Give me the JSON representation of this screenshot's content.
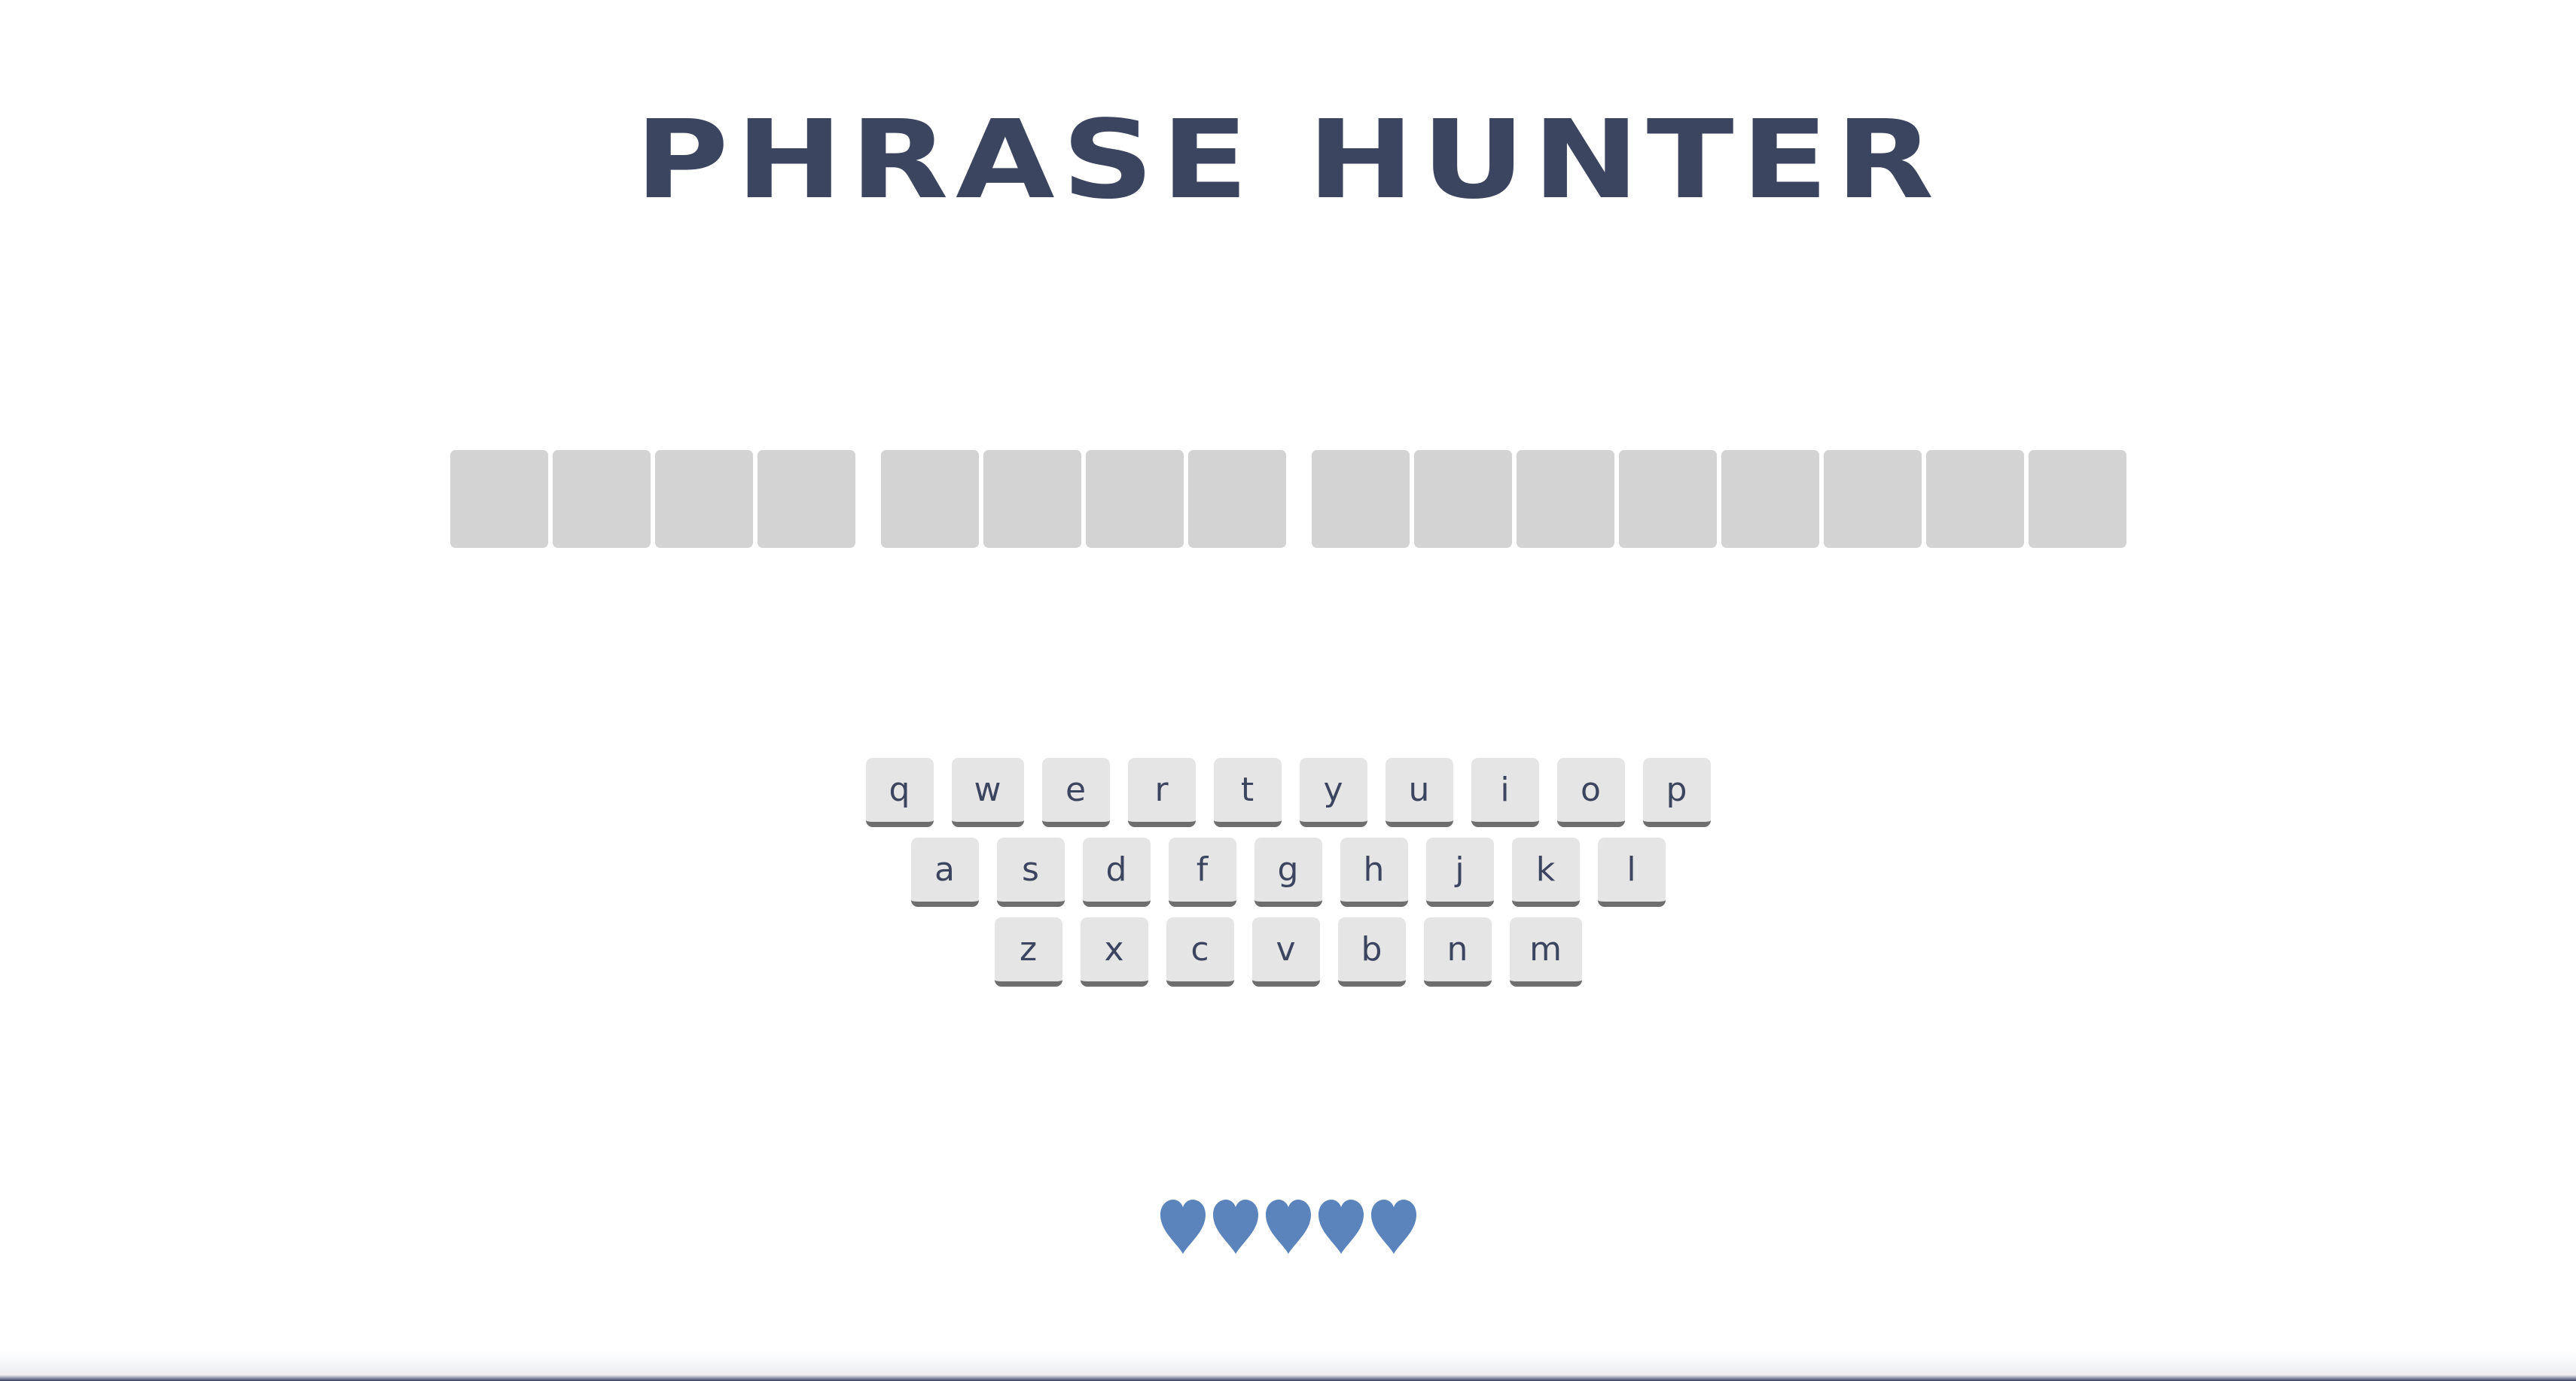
{
  "title": "PHRASE HUNTER",
  "phrase": {
    "words": [
      {
        "letters": [
          "",
          "",
          "",
          ""
        ]
      },
      {
        "letters": [
          "",
          "",
          "",
          ""
        ]
      },
      {
        "letters": [
          "",
          "",
          "",
          "",
          "",
          "",
          "",
          ""
        ]
      }
    ]
  },
  "keyboard": {
    "rows": [
      [
        "q",
        "w",
        "e",
        "r",
        "t",
        "y",
        "u",
        "i",
        "o",
        "p"
      ],
      [
        "a",
        "s",
        "d",
        "f",
        "g",
        "h",
        "j",
        "k",
        "l"
      ],
      [
        "z",
        "x",
        "c",
        "v",
        "b",
        "n",
        "m"
      ]
    ]
  },
  "lives": {
    "remaining": 5,
    "total": 5,
    "icon": "heart-icon",
    "color": "#5b84bd"
  },
  "colors": {
    "title": "#3c4560",
    "letter_box": "#d3d3d3",
    "key_face": "#e5e5e5",
    "key_shadow": "#6e6e6e"
  }
}
